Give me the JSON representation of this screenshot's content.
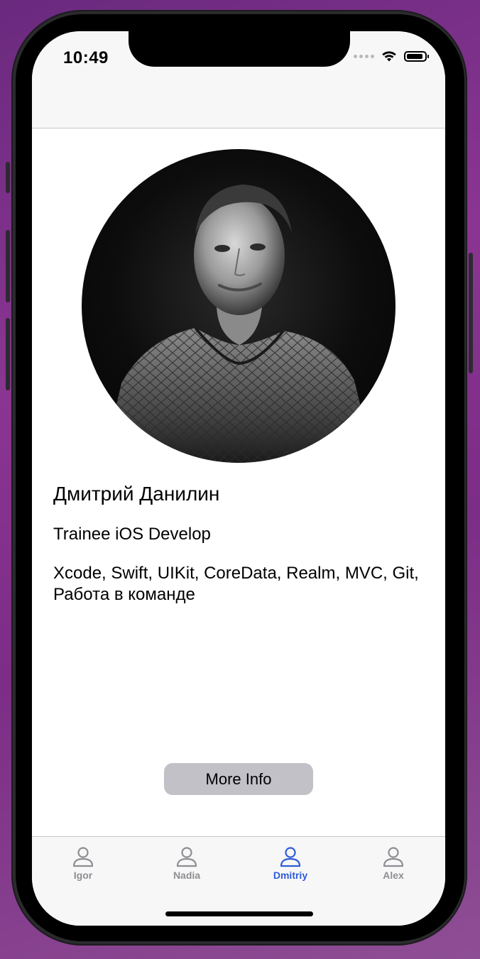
{
  "status_bar": {
    "time": "10:49"
  },
  "profile": {
    "name": "Дмитрий Данилин",
    "position": "Trainee iOS Develop",
    "skills": "Xcode, Swift, UIKit, CoreData, Realm, MVC, Git, Работа в команде"
  },
  "actions": {
    "more_info_label": "More Info"
  },
  "tab_bar": {
    "tabs": [
      {
        "label": "Igor",
        "icon": "person-icon"
      },
      {
        "label": "Nadia",
        "icon": "person-icon"
      },
      {
        "label": "Dmitriy",
        "icon": "person-icon",
        "selected": true
      },
      {
        "label": "Alex",
        "icon": "person-icon"
      }
    ]
  },
  "colors": {
    "tint": "#2f5bd8",
    "inactive_tab": "#8e8e93",
    "button_bg": "#c1c1c7",
    "desktop_background": "#7c2d86"
  }
}
